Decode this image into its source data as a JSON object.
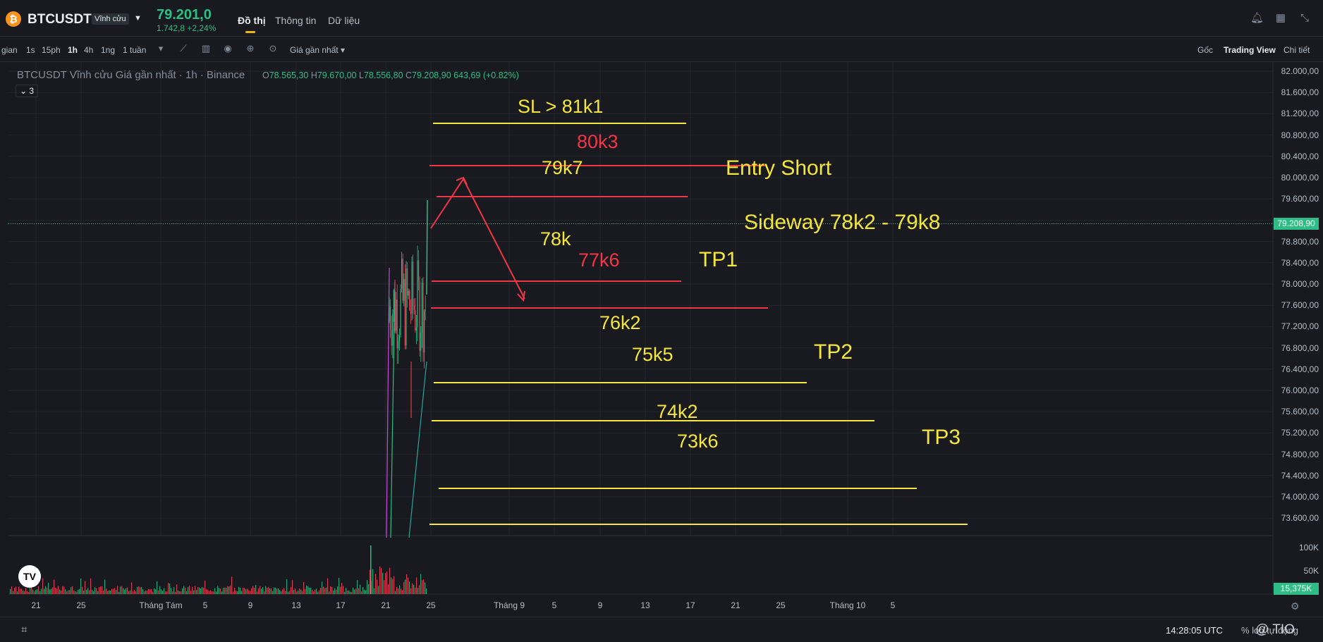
{
  "header": {
    "coin_icon": "bitcoin-icon",
    "symbol": "BTCUSDT",
    "badge": "Vĩnh cửu",
    "last_price": "79.201,0",
    "change": "1.742,8 +2,24%",
    "tabs": [
      "Đồ thị",
      "Thông tin",
      "Dữ liệu"
    ],
    "icons": [
      "bell-icon",
      "layout-grid-icon",
      "minimize-icon"
    ]
  },
  "toolbar": {
    "intervals": [
      "gian",
      "1s",
      "15ph",
      "1h",
      "4h",
      "1ng",
      "1 tuần"
    ],
    "active_interval": "1h",
    "price_type": "Giá gần nhất ▾",
    "views": [
      "Gốc",
      "Trading View",
      "Chi tiết"
    ],
    "active_view": "Trading View"
  },
  "chart": {
    "legend": "BTCUSDT Vĩnh cửu Giá gần nhất · 1h · Binance",
    "ohlc": {
      "o_label": "O",
      "o": "78.565,30",
      "h_label": "H",
      "h": "79.670,00",
      "l_label": "L",
      "l": "78.556,80",
      "c_label": "C",
      "c": "79.208,90",
      "change": "643,69 (+0.82%)"
    },
    "indicators_count": "3",
    "current_price_tag": "79.208,90",
    "volume_tag": "15,375K",
    "y_labels": [
      "82.000,00",
      "81.600,00",
      "81.200,00",
      "80.800,00",
      "80.400,00",
      "80.000,00",
      "79.600,00",
      "78.800,00",
      "78.400,00",
      "78.000,00",
      "77.600,00",
      "77.200,00",
      "76.800,00",
      "76.400,00",
      "76.000,00",
      "75.600,00",
      "75.200,00",
      "74.800,00",
      "74.400,00",
      "74.000,00",
      "73.600,00"
    ],
    "vol_labels": [
      "100K",
      "50K"
    ],
    "x_labels": [
      "21",
      "25",
      "Tháng Tám",
      "5",
      "9",
      "13",
      "17",
      "21",
      "25",
      "Tháng 9",
      "5",
      "9",
      "13",
      "17",
      "21",
      "25",
      "Tháng 10",
      "5"
    ]
  },
  "annotations": {
    "sl": "SL > 81k1",
    "r1": "80k3",
    "entry": "79k7",
    "entry_label": "Entry Short",
    "sideway": "Sideway 78k2 - 79k8",
    "l78": "78k",
    "l776": "77k6",
    "tp1": "TP1",
    "l762": "76k2",
    "l755": "75k5",
    "tp2": "TP2",
    "l742": "74k2",
    "l736": "73k6",
    "tp3": "TP3"
  },
  "footer": {
    "time": "14:28:05 UTC",
    "options": "% log tự động",
    "watermark": "@ TIO"
  },
  "colors": {
    "up": "#2ebd85",
    "down": "#f6465d",
    "annotation_yellow": "#f5e63b",
    "annotation_red": "#f23645",
    "accent": "#f0b90b"
  }
}
